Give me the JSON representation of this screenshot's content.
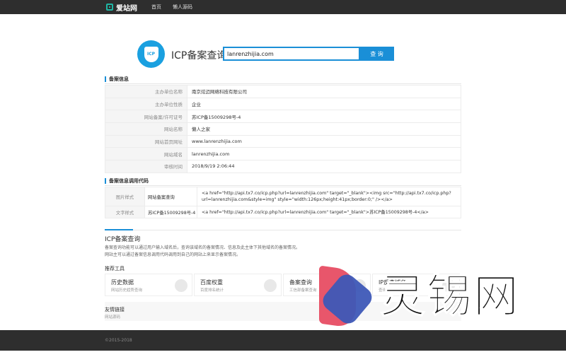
{
  "header": {
    "logo_text": "爱站网",
    "nav": [
      "首页",
      "懒人源码"
    ]
  },
  "search": {
    "title": "ICP备案查询",
    "badge": "ICP",
    "value": "lanrenzhijia.com",
    "button": "查 询"
  },
  "record": {
    "section_title": "备案信息",
    "rows": [
      {
        "key": "主办单位名称",
        "value": "南京炫迈网络科技有限公司"
      },
      {
        "key": "主办单位性质",
        "value": "企业"
      },
      {
        "key": "网站备案/许可证号",
        "value": "苏ICP备15009298号-4"
      },
      {
        "key": "网站名称",
        "value": "懒人之家"
      },
      {
        "key": "网站首页网址",
        "value": "www.lanrenzhijia.com"
      },
      {
        "key": "网站域名",
        "value": "lanrenzhijia.com"
      },
      {
        "key": "审核时间",
        "value": "2018/9/19 2:06:44"
      }
    ]
  },
  "code": {
    "section_title": "备案信息调用代码",
    "rows": [
      {
        "key": "图片样式",
        "name": "网站备案查询",
        "code": "<a href=\"http://api.tx7.co/icp.php?url=lanrenzhijia.com\" target=\"_blank\"><img src=\"http://api.tx7.co/icp.php?url=lanrenzhijia.com&style=img\" style=\"width:126px;height:41px;border:0;\" /></a>"
      },
      {
        "key": "文字样式",
        "name": "苏ICP备15009298号-4",
        "code": "<a href=\"http://api.tx7.co/icp.php?url=lanrenzhijia.com\" target=\"_blank\">苏ICP备15009298号-4</a>"
      }
    ]
  },
  "icp_query": {
    "heading": "ICP备案查询",
    "desc1": "备案查询功能可以通过用户输入域名后，查询该域名的备案情况、信息及此主体下其他域名的备案情况。",
    "desc2": "网站主可以通过备案信息调用代码调用到自己的网站上来显示备案情况。"
  },
  "tools": {
    "title": "推荐工具",
    "items": [
      {
        "name": "历史数据",
        "desc": "网站历史趋势查询"
      },
      {
        "name": "百度权重",
        "desc": "百度排名统计"
      },
      {
        "name": "备案查询",
        "desc": "工信部备案查询"
      },
      {
        "name": "IP反查域名",
        "desc": "查询同IP网站"
      }
    ]
  },
  "links": {
    "title": "友情链接",
    "item": "网站源码"
  },
  "footer": {
    "copyright": "©2015-2018"
  },
  "watermark": {
    "text": "灵锡网"
  }
}
